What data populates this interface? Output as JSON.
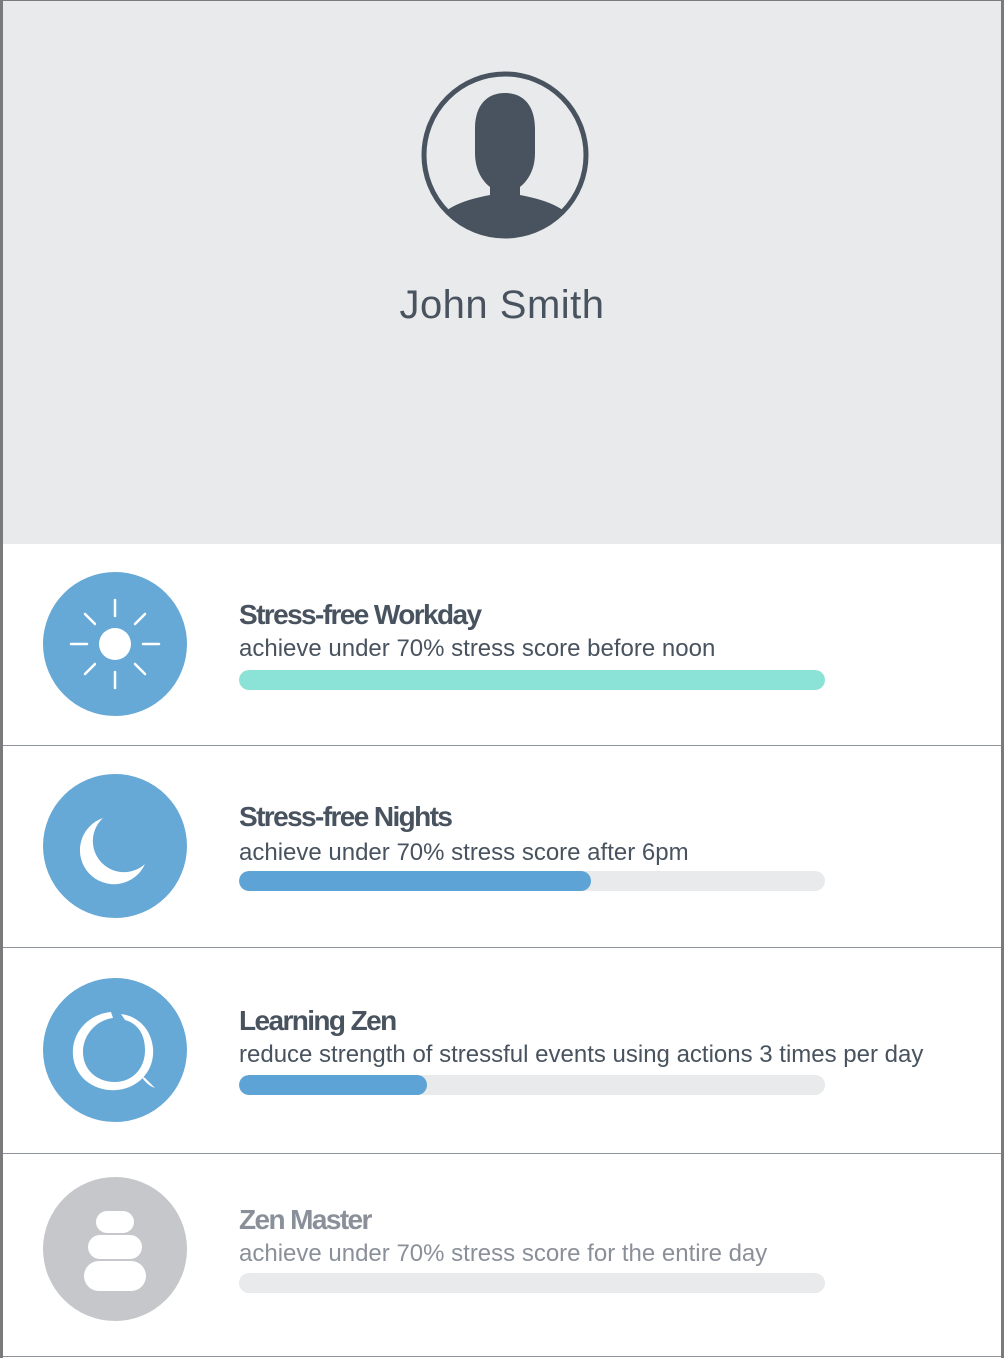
{
  "profile": {
    "name": "John Smith",
    "avatar_icon": "user-silhouette-icon"
  },
  "colors": {
    "header_bg": "#e9eaeb",
    "text_dark": "#48535f",
    "icon_blue": "#66a8d6",
    "icon_gray": "#c5c7ca",
    "progress_track": "#e9eaeb",
    "progress_teal": "#8ae3d6",
    "progress_blue": "#5ea3d5"
  },
  "goals": [
    {
      "title": "Stress-free Workday",
      "description": "achieve under 70% stress score before noon",
      "icon": "sun-icon",
      "progress": 1.0,
      "state": "completed"
    },
    {
      "title": "Stress-free Nights",
      "description": "achieve under 70% stress score after 6pm",
      "icon": "moon-icon",
      "progress": 0.6,
      "state": "in-progress"
    },
    {
      "title": "Learning Zen",
      "description": "reduce strength of stressful events using actions 3 times per day",
      "icon": "enso-circle-icon",
      "progress": 0.32,
      "state": "in-progress"
    },
    {
      "title": "Zen Master",
      "description": "achieve under 70% stress score for the entire day",
      "icon": "stacked-stones-icon",
      "progress": 0,
      "state": "locked"
    }
  ]
}
